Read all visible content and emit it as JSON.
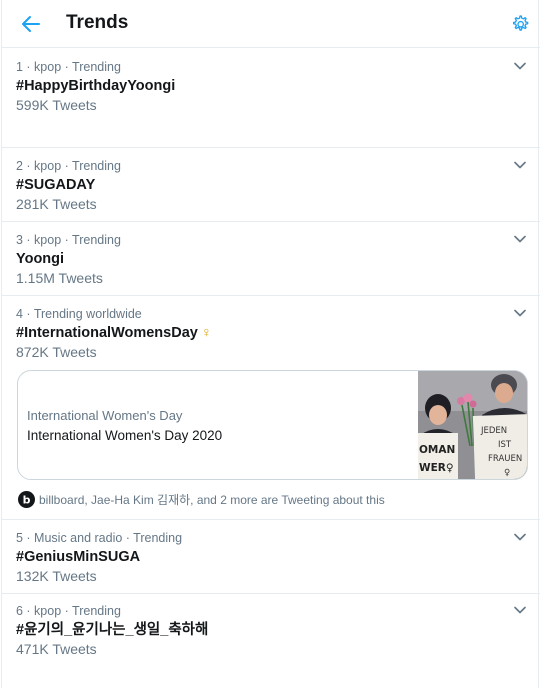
{
  "header": {
    "title": "Trends",
    "back_icon": "arrow-left-icon",
    "settings_icon": "gear-icon",
    "accent": "#1da1f2"
  },
  "trends": [
    {
      "meta": "1 · kpop · Trending",
      "name": "#HappyBirthdayYoongi",
      "count": "599K Tweets"
    },
    {
      "meta": "2 · kpop · Trending",
      "name": "#SUGADAY",
      "count": "281K Tweets"
    },
    {
      "meta": "3 · kpop · Trending",
      "name": "Yoongi",
      "count": "1.15M Tweets"
    },
    {
      "meta": "4 · Trending worldwide",
      "name": "#InternationalWomensDay",
      "name_emoji": "♀",
      "count": "872K Tweets",
      "card": {
        "source": "International Women's Day",
        "title": "International Women's Day 2020",
        "image_sign_left": "OMAN\nWER♀",
        "image_sign_right": "JEDEN\nIST\nFRAUEN\n♀"
      },
      "tweeting": "billboard, Jae-Ha Kim 김재하, and 2 more are Tweeting about this"
    },
    {
      "meta": "5 · Music and radio · Trending",
      "name": "#GeniusMinSUGA",
      "count": "132K Tweets"
    },
    {
      "meta": "6 · kpop · Trending",
      "name": "#윤기의_윤기나는_생일_축하해",
      "count": "471K Tweets"
    }
  ],
  "colors": {
    "secondary_text": "#657786",
    "divider": "#e6ecf0",
    "emoji_gold": "#e3a91d"
  }
}
